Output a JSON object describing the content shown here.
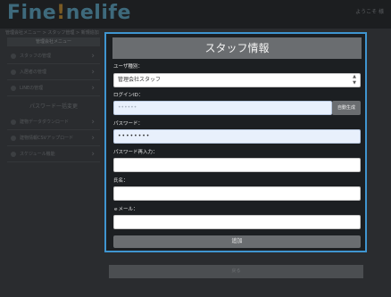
{
  "background": {
    "logo": {
      "main": "Fine",
      "accent": "!",
      "rest": "nelife"
    },
    "user_info": "ようこそ 様",
    "breadcrumb": "管理会社メニュー > スタッフ管理 > 新規追加",
    "sidebar": {
      "title": "管理会社メニュー",
      "items": [
        "スタッフの管理",
        "入居者の管理",
        "LINEの管理"
      ],
      "section": "パスワード一括変更",
      "sub_items": [
        "建物データダウンロード",
        "建物情報CSVアップロード",
        "スケジュール機能"
      ]
    },
    "bottom_button": "戻る"
  },
  "modal": {
    "title": "スタッフ情報",
    "user_type_label": "ユーザ種別：",
    "user_type_value": "管理会社スタッフ",
    "login_id_label": "ログインID：",
    "login_id_value": "••••••",
    "auto_generate_label": "自動生成",
    "password_label": "パスワード：",
    "password_value": "••••••••",
    "password_confirm_label": "パスワード再入力：",
    "password_confirm_value": "",
    "name_label": "氏名：",
    "name_value": "",
    "email_label": "ｅメール：",
    "email_value": "",
    "submit_label": "追加"
  },
  "colors": {
    "modal_border": "#3f95d0",
    "title_bar": "#6a6d70",
    "autofill_bg": "#e8f0fc"
  }
}
